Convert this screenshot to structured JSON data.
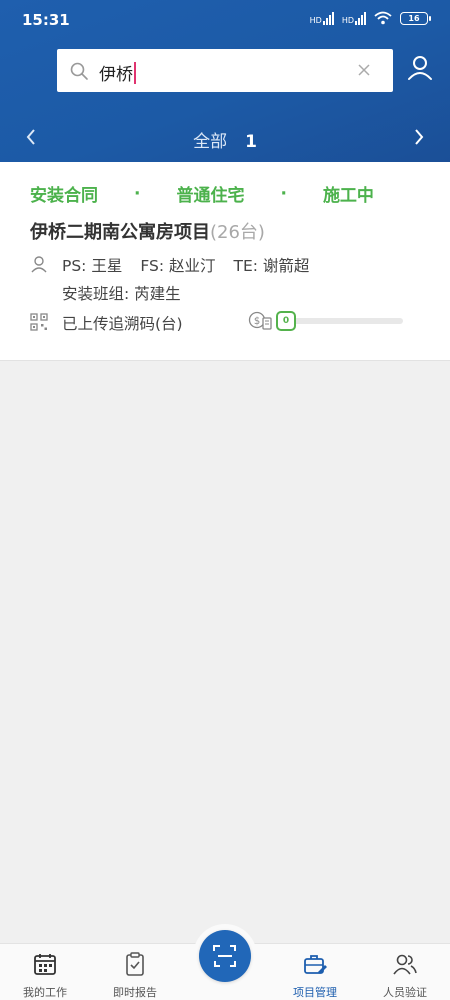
{
  "status_bar": {
    "time": "15:31",
    "signal1_label": "HD",
    "signal2_label": "HD",
    "battery": "16"
  },
  "search": {
    "value": "伊桥"
  },
  "nav": {
    "label": "全部",
    "count": "1"
  },
  "card": {
    "tags": [
      "安装合同",
      "普通住宅",
      "施工中"
    ],
    "separator": "·",
    "title": "伊桥二期南公寓房项目",
    "units": "(26台)",
    "staff": [
      "PS: 王星",
      "FS: 赵业汀",
      "TE: 谢箭超"
    ],
    "team": "安装班组: 芮建生",
    "qr_label": "已上传追溯码(台)",
    "uploaded_count": "0",
    "progress_fraction": 0.0
  },
  "bottom_nav": {
    "tabs": [
      {
        "label": "我的工作",
        "icon": "calendar-icon"
      },
      {
        "label": "即时报告",
        "icon": "clipboard-check-icon"
      },
      {
        "label": "项目管理",
        "icon": "briefcase-edit-icon"
      },
      {
        "label": "人员验证",
        "icon": "people-icon"
      }
    ],
    "active_tab": 2,
    "center_icon": "scan-icon"
  },
  "colors": {
    "header": "#1f5fae",
    "accent_green": "#4cb24c",
    "active_blue": "#1d5eae"
  }
}
